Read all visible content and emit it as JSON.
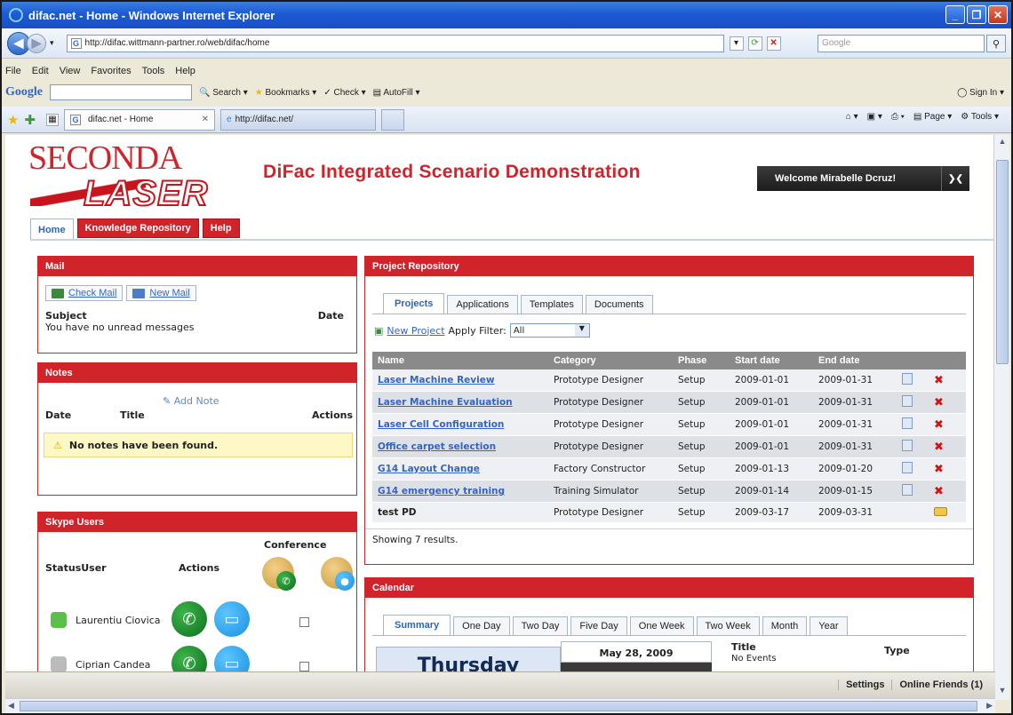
{
  "browser": {
    "window_title": "difac.net - Home - Windows Internet Explorer",
    "url": "http://difac.wittmann-partner.ro/web/difac/home",
    "search_placeholder": "Google",
    "menu": [
      "File",
      "Edit",
      "View",
      "Favorites",
      "Tools",
      "Help"
    ],
    "google_bar": {
      "logo": "Google",
      "search": "Search",
      "bookmarks": "Bookmarks",
      "check": "Check",
      "autofill": "AutoFill",
      "sign_in": "Sign In"
    },
    "tabs": [
      "difac.net - Home",
      "http://difac.net/"
    ],
    "command_bar": {
      "page": "Page",
      "tools": "Tools"
    },
    "status": {
      "settings": "Settings",
      "online_friends": "Online Friends (1)"
    }
  },
  "site": {
    "logo_top": "SECONDA",
    "logo_bottom": "LASER",
    "title": "DiFac Integrated Scenario Demonstration",
    "welcome": "Welcome Mirabelle Dcruz!",
    "nav": [
      "Home",
      "Knowledge Repository",
      "Help"
    ]
  },
  "mail": {
    "header": "Mail",
    "check_mail": "Check Mail",
    "new_mail": "New Mail",
    "col_subject": "Subject",
    "col_date": "Date",
    "empty": "You have no unread messages"
  },
  "notes": {
    "header": "Notes",
    "add_note": "Add Note",
    "col_date": "Date",
    "col_title": "Title",
    "col_actions": "Actions",
    "empty": "No notes have been found."
  },
  "skype": {
    "header": "Skype Users",
    "col_conference": "Conference",
    "col_status_user": "StatusUser",
    "col_actions": "Actions",
    "users": [
      {
        "name": "Laurentiu Ciovica",
        "status": "online"
      },
      {
        "name": "Ciprian Candea",
        "status": "offline"
      }
    ]
  },
  "projects": {
    "header": "Project Repository",
    "tabs": [
      "Projects",
      "Applications",
      "Templates",
      "Documents"
    ],
    "new_project": "New Project",
    "apply_filter_label": "Apply Filter:",
    "filter_value": "All",
    "columns": [
      "Name",
      "Category",
      "Phase",
      "Start date",
      "End date"
    ],
    "rows": [
      {
        "name": "Laser Machine Review",
        "category": "Prototype Designer",
        "phase": "Setup",
        "start": "2009-01-01",
        "end": "2009-01-31"
      },
      {
        "name": "Laser Machine Evaluation",
        "category": "Prototype Designer",
        "phase": "Setup",
        "start": "2009-01-01",
        "end": "2009-01-31"
      },
      {
        "name": "Laser Cell Configuration",
        "category": "Prototype Designer",
        "phase": "Setup",
        "start": "2009-01-01",
        "end": "2009-01-31"
      },
      {
        "name": "Office carpet selection",
        "category": "Prototype Designer",
        "phase": "Setup",
        "start": "2009-01-01",
        "end": "2009-01-31"
      },
      {
        "name": "G14 Layout Change",
        "category": "Factory Constructor",
        "phase": "Setup",
        "start": "2009-01-13",
        "end": "2009-01-20"
      },
      {
        "name": "G14 emergency training",
        "category": "Training Simulator",
        "phase": "Setup",
        "start": "2009-01-14",
        "end": "2009-01-15"
      },
      {
        "name": "test PD",
        "category": "Prototype Designer",
        "phase": "Setup",
        "start": "2009-03-17",
        "end": "2009-03-31"
      }
    ],
    "footer": "Showing 7 results."
  },
  "calendar": {
    "header": "Calendar",
    "tabs": [
      "Summary",
      "One Day",
      "Two Day",
      "Five Day",
      "One Week",
      "Two Week",
      "Month",
      "Year"
    ],
    "day_name": "Thursday",
    "date": "May 28, 2009",
    "col_title": "Title",
    "col_type": "Type",
    "empty": "No Events"
  }
}
